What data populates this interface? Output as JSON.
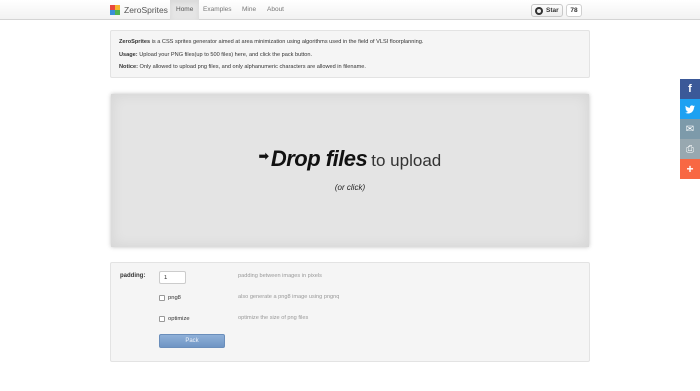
{
  "brand": {
    "name": "ZeroSprites"
  },
  "nav": {
    "items": [
      {
        "label": "Home",
        "active": true
      },
      {
        "label": "Examples",
        "active": false
      },
      {
        "label": "Mine",
        "active": false
      },
      {
        "label": "About",
        "active": false
      }
    ]
  },
  "github": {
    "star_label": "Star",
    "count": "78"
  },
  "info": {
    "intro_name": "ZeroSprites",
    "intro_text": " is a CSS sprites generator aimed at area minimization using algorithms used in the field of VLSI floorplanning.",
    "usage_label": "Usage:",
    "usage_text": " Upload your PNG files(up to 500 files) here, and click the pack button.",
    "notice_label": "Notice:",
    "notice_text": " Only allowed to upload png files, and only alphanumeric characters are allowed in filename."
  },
  "dropzone": {
    "arrow": "➡",
    "main": "Drop files",
    "sub": "to upload",
    "click": "(or click)"
  },
  "options": {
    "padding_label": "padding:",
    "padding_value": "1",
    "padding_help": "padding between images in pixels",
    "png8_label": "png8",
    "png8_help": "also generate a png8 image using pngnq",
    "optimize_label": "optimize",
    "optimize_help": "optimize the size of png files",
    "pack_label": "Pack"
  },
  "share": [
    {
      "icon": "facebook-icon",
      "glyph": "f",
      "color": "#3b5998"
    },
    {
      "icon": "twitter-icon",
      "glyph": "🐦",
      "color": "#1da1f2"
    },
    {
      "icon": "email-icon",
      "glyph": "✉",
      "color": "#7d9aaa"
    },
    {
      "icon": "print-icon",
      "glyph": "⎙",
      "color": "#98a8b0"
    },
    {
      "icon": "more-icon",
      "glyph": "+",
      "color": "#f86843"
    }
  ],
  "colors": {
    "pack_button": "#7aa0cc",
    "logo_tl": "#e8483f",
    "logo_tr": "#f5b52e",
    "logo_bl": "#3a8fd8",
    "logo_br": "#4fb34f"
  }
}
